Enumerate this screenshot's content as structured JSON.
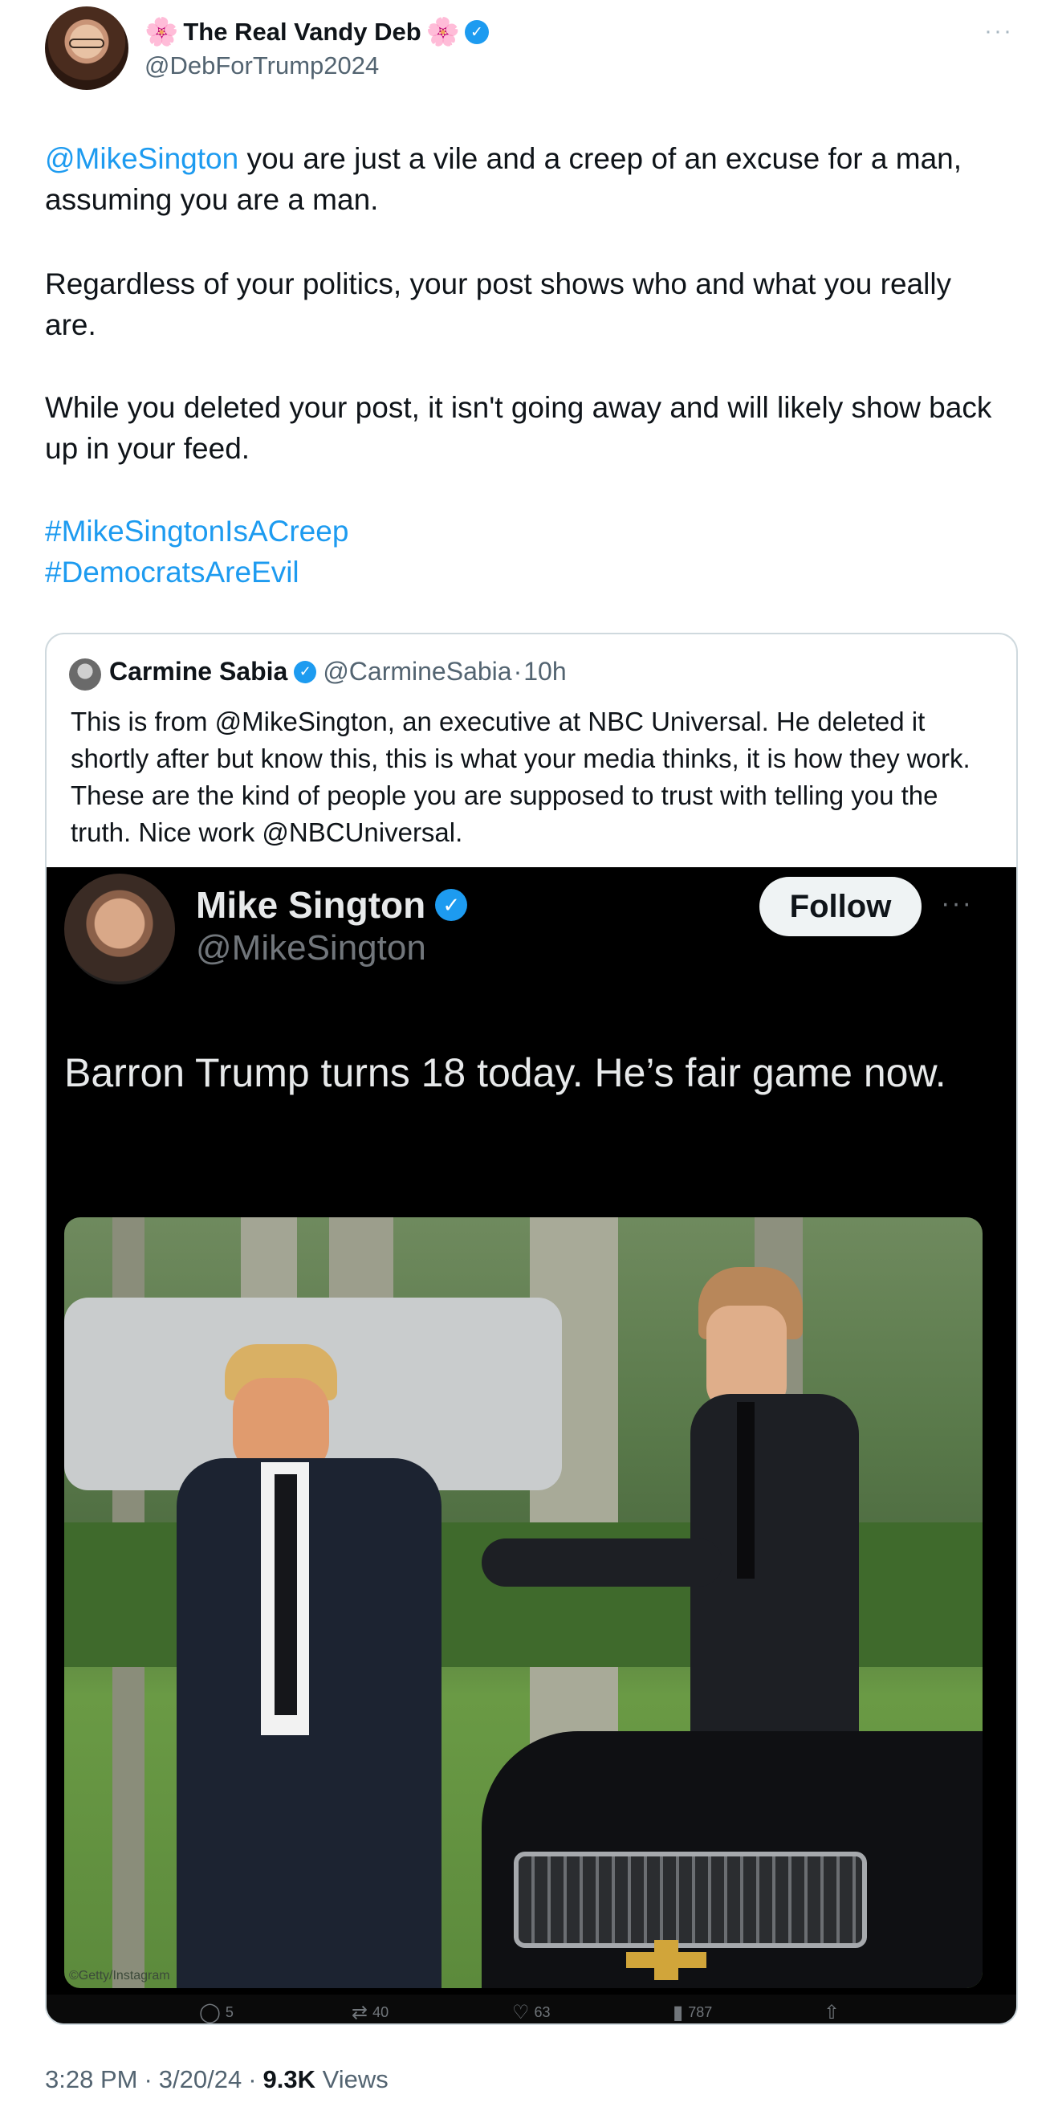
{
  "author": {
    "display_name": "The Real Vandy Deb",
    "handle": "@DebForTrump2024",
    "name_decoration": "🌸",
    "verified_glyph": "✓",
    "more_glyph": "···"
  },
  "tweet": {
    "mention": "@MikeSington",
    "para1_rest": " you are just a vile and a creep of an excuse for a man, assuming you are a man.",
    "para2": "Regardless of your politics, your post shows who and what you really are.",
    "para3": "While you deleted your post, it isn't going away and will likely show back up in your feed.",
    "hashtags": [
      "#MikeSingtonIsACreep",
      "#DemocratsAreEvil"
    ]
  },
  "quote": {
    "name": "Carmine Sabia",
    "handle": "@CarmineSabia",
    "separator": "·",
    "time": "10h",
    "text": "This is from @MikeSington, an executive at NBC Universal. He deleted it shortly after but know this, this is what your media thinks, it is how they work. These are the kind of people you are supposed to trust with telling you the truth. Nice work @NBCUniversal."
  },
  "embedded_post": {
    "name": "Mike Sington",
    "handle": "@MikeSington",
    "follow_label": "Follow",
    "more_glyph": "···",
    "text": "Barron Trump turns 18 today. He’s fair game now.",
    "photo_caption": "©Getty/Instagram",
    "actions": [
      {
        "icon": "reply-icon",
        "glyph": "◯",
        "count": "5"
      },
      {
        "icon": "repost-icon",
        "glyph": "⇄",
        "count": "40"
      },
      {
        "icon": "like-icon",
        "glyph": "♡",
        "count": "63"
      },
      {
        "icon": "views-icon",
        "glyph": "▮",
        "count": "787"
      },
      {
        "icon": "share-icon",
        "glyph": "⇧",
        "count": ""
      }
    ]
  },
  "footer": {
    "time": "3:28 PM",
    "sep": "·",
    "date": "3/20/24",
    "views_count": "9.3K",
    "views_label": "Views"
  },
  "colors": {
    "link": "#1d9bf0",
    "verified": "#1d9bf0",
    "text_primary": "#0f1419",
    "text_secondary": "#536471",
    "dark_bg": "#000000"
  }
}
